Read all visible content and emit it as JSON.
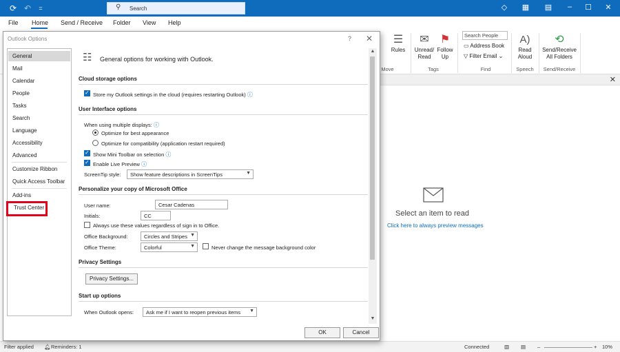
{
  "titlebar": {
    "search_placeholder": "Search",
    "quick_access_label": "="
  },
  "menu": {
    "tabs": [
      "File",
      "Home",
      "Send / Receive",
      "Folder",
      "View",
      "Help"
    ]
  },
  "ribbon": {
    "rules_label": "Rules",
    "move_group": "Move",
    "unread_read_label": "Unread/ Read",
    "follow_up_label": "Follow Up",
    "tags_group": "Tags",
    "search_people_placeholder": "Search People",
    "address_book_label": "Address Book",
    "filter_email_label": "Filter Email",
    "find_group": "Find",
    "read_aloud_label": "Read Aloud",
    "speech_group": "Speech",
    "send_receive_all_label": "Send/Receive All Folders",
    "send_receive_group": "Send/Receive"
  },
  "reading_pane": {
    "select_text": "Select an item to read",
    "preview_link": "Click here to always preview messages"
  },
  "statusbar": {
    "filter_applied": "Filter applied",
    "reminders": "Reminders: 1",
    "connected": "Connected",
    "zoom": "10%"
  },
  "dialog": {
    "title": "Outlook Options",
    "help": "?",
    "nav": [
      "General",
      "Mail",
      "Calendar",
      "People",
      "Tasks",
      "Search",
      "Language",
      "Accessibility",
      "Advanced",
      "Customize Ribbon",
      "Quick Access Toolbar",
      "Add-ins",
      "Trust Center"
    ],
    "selected_nav": "General",
    "highlighted_nav": "Trust Center",
    "header": "General options for working with Outlook.",
    "cloud": {
      "heading": "Cloud storage options",
      "store_settings": "Store my Outlook settings in the cloud (requires restarting Outlook)"
    },
    "ui": {
      "heading": "User Interface options",
      "multiple_displays": "When using multiple displays:",
      "optimize_appearance": "Optimize for best appearance",
      "optimize_compat": "Optimize for compatibility (application restart required)",
      "mini_toolbar": "Show Mini Toolbar on selection",
      "live_preview": "Enable Live Preview",
      "screentip_label": "ScreenTip style:",
      "screentip_value": "Show feature descriptions in ScreenTips"
    },
    "personalize": {
      "heading": "Personalize your copy of Microsoft Office",
      "user_name_label": "User name:",
      "user_name_value": "Cesar Cadenas",
      "initials_label": "Initials:",
      "initials_value": "CC",
      "always_use": "Always use these values regardless of sign in to Office.",
      "background_label": "Office Background:",
      "background_value": "Circles and Stripes",
      "theme_label": "Office Theme:",
      "theme_value": "Colorful",
      "never_change_bg": "Never change the message background color"
    },
    "privacy": {
      "heading": "Privacy Settings",
      "button": "Privacy Settings..."
    },
    "startup": {
      "heading": "Start up options",
      "when_opens_label": "When Outlook opens:",
      "when_opens_value": "Ask me if I want to reopen previous items"
    },
    "ok": "OK",
    "cancel": "Cancel"
  },
  "colors": {
    "accent": "#0f6cbd",
    "highlight_box": "#e3001b"
  }
}
